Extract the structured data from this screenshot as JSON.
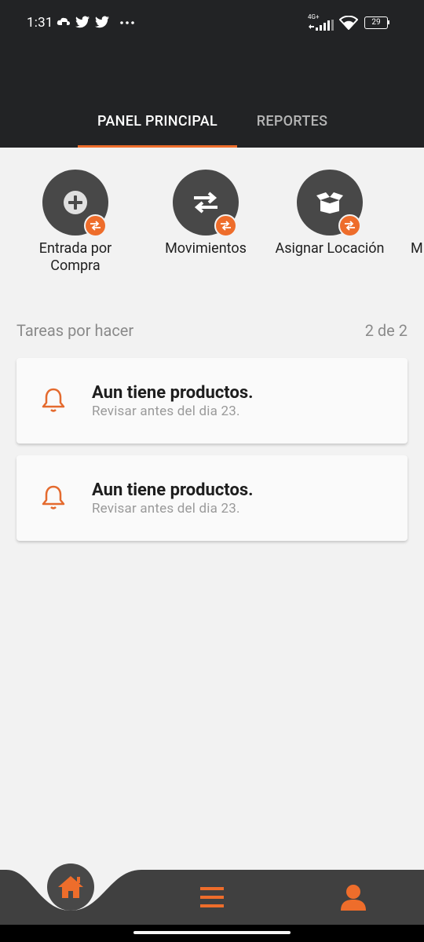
{
  "status_bar": {
    "time": "1:31",
    "network": "4G+",
    "battery": "29"
  },
  "tabs": [
    {
      "label": "PANEL PRINCIPAL",
      "active": true
    },
    {
      "label": "REPORTES",
      "active": false
    }
  ],
  "quick_actions": [
    {
      "label": "Entrada por Compra",
      "icon": "plus-circle-icon"
    },
    {
      "label": "Movimientos",
      "icon": "swap-arrows-icon"
    },
    {
      "label": "Asignar Locación",
      "icon": "open-box-icon"
    },
    {
      "label": "M",
      "icon": "partial-action-icon"
    }
  ],
  "tasks": {
    "heading": "Tareas por hacer",
    "count": "2 de 2",
    "items": [
      {
        "title": "Aun tiene productos.",
        "subtitle": "Revisar antes del dia 23."
      },
      {
        "title": "Aun tiene productos.",
        "subtitle": "Revisar antes del dia 23."
      }
    ]
  },
  "bottom_nav": {
    "items": [
      "home-icon",
      "menu-icon",
      "user-icon"
    ]
  },
  "colors": {
    "accent": "#ee6d2b",
    "header_bg": "#222325",
    "icon_circle": "#484848",
    "nav_bg": "#404040",
    "page_bg": "#f2f2f2"
  }
}
